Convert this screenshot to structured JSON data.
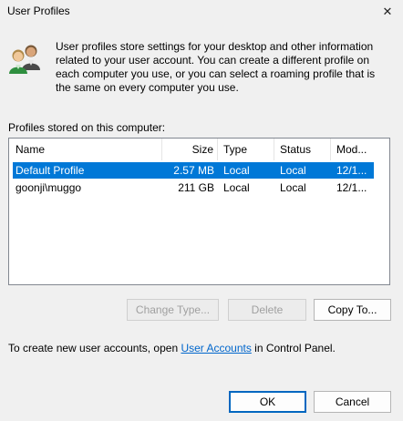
{
  "window": {
    "title": "User Profiles",
    "close_glyph": "✕"
  },
  "intro_text": "User profiles store settings for your desktop and other information related to your user account. You can create a different profile on each computer you use, or you can select a roaming profile that is the same on every computer you use.",
  "profiles_label": "Profiles stored on this computer:",
  "table": {
    "columns": [
      "Name",
      "Size",
      "Type",
      "Status",
      "Mod..."
    ],
    "rows": [
      {
        "name": "Default Profile",
        "size": "2.57 MB",
        "type": "Local",
        "status": "Local",
        "modified": "12/1...",
        "selected": true
      },
      {
        "name": "goonji\\muggo",
        "size": "211 GB",
        "type": "Local",
        "status": "Local",
        "modified": "12/1...",
        "selected": false
      }
    ]
  },
  "buttons": {
    "change_type": "Change Type...",
    "delete": "Delete",
    "copy_to": "Copy To...",
    "ok": "OK",
    "cancel": "Cancel"
  },
  "footer": {
    "prefix": "To create new user accounts, open ",
    "link": "User Accounts",
    "suffix": " in Control Panel."
  },
  "colors": {
    "selection": "#0078d7",
    "link": "#0066cc",
    "default_button_border": "#0067c0"
  },
  "icons": {
    "users": "users-icon",
    "close": "close-icon"
  }
}
